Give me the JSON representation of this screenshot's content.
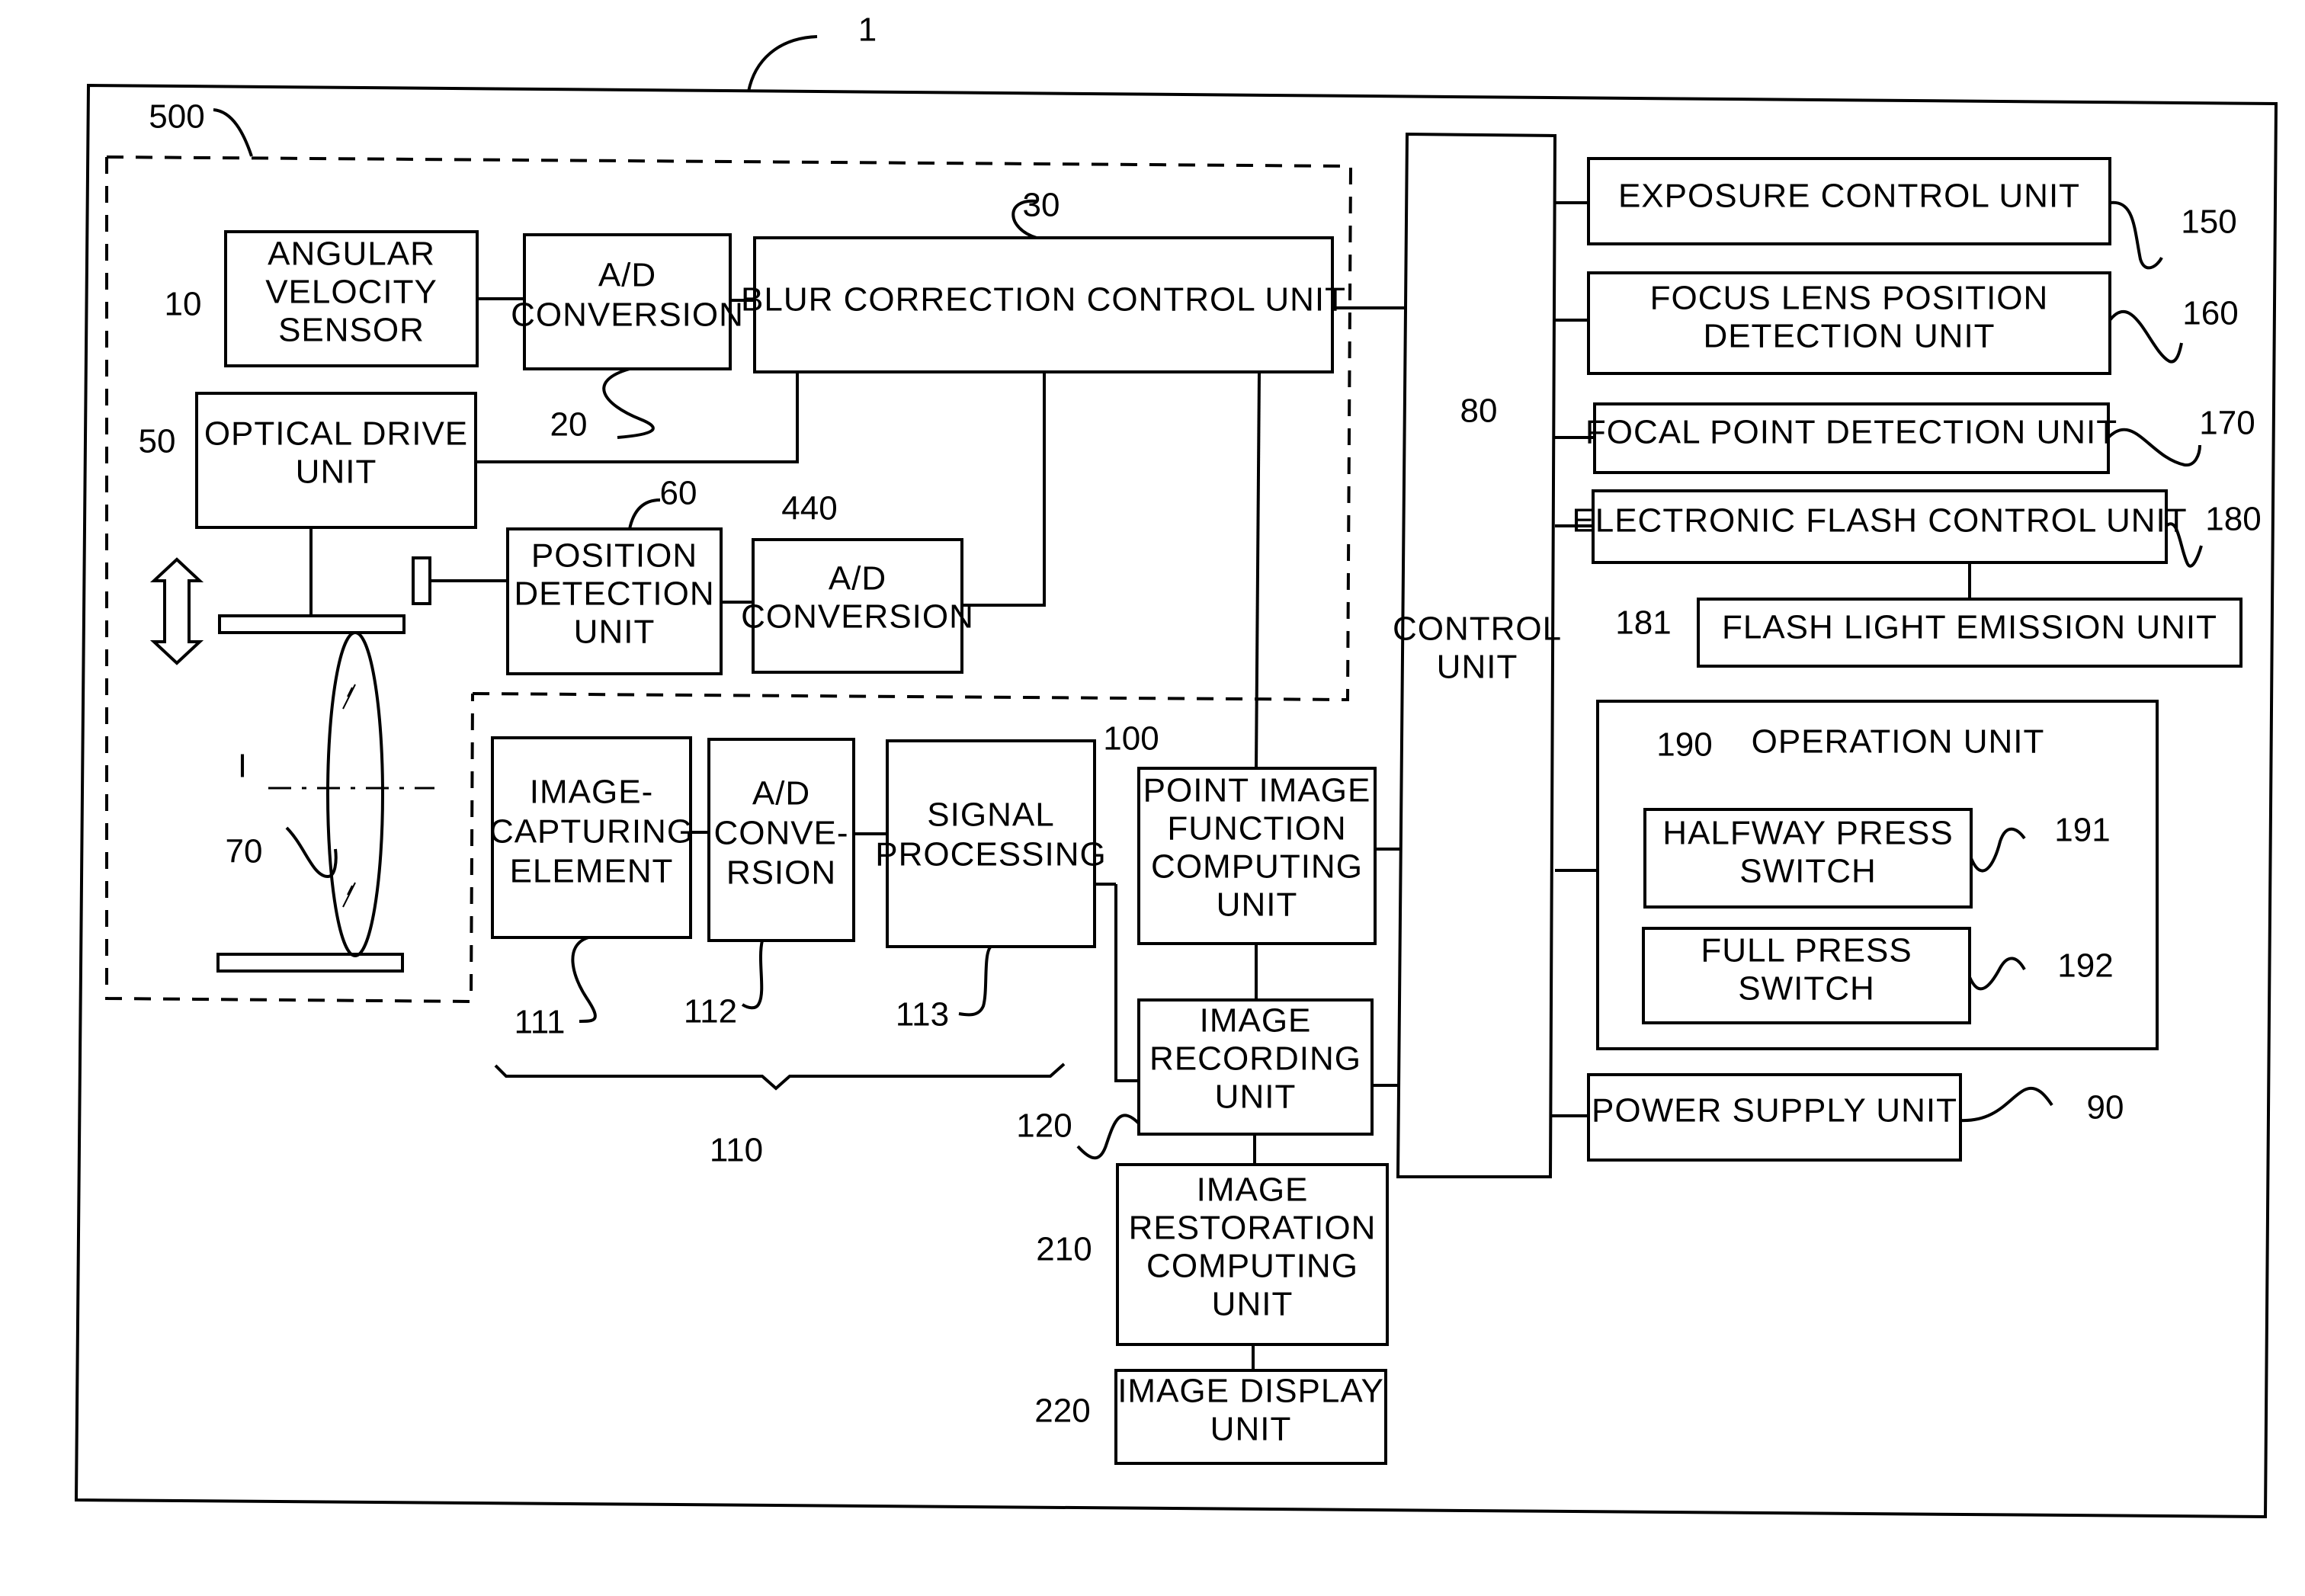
{
  "figure": {
    "ref": "1",
    "subsystem_ref": "500",
    "optical_axis_label": "I"
  },
  "blocks": {
    "angular_velocity_sensor": {
      "ref": "10",
      "lines": [
        "ANGULAR",
        "VELOCITY",
        "SENSOR"
      ]
    },
    "ad_conversion_20": {
      "ref": "20",
      "lines": [
        "A/D",
        "CONVERSION"
      ]
    },
    "blur_correction_control_unit": {
      "ref": "30",
      "lines": [
        "BLUR CORRECTION CONTROL UNIT"
      ]
    },
    "optical_drive_unit": {
      "ref": "50",
      "lines": [
        "OPTICAL DRIVE",
        "UNIT"
      ]
    },
    "position_detection_unit": {
      "ref": "60",
      "lines": [
        "POSITION",
        "DETECTION",
        "UNIT"
      ]
    },
    "ad_conversion_440": {
      "ref": "440",
      "lines": [
        "A/D",
        "CONVERSION"
      ]
    },
    "lens": {
      "ref": "70"
    },
    "control_unit": {
      "ref": "80",
      "lines": [
        "CONTROL",
        "UNIT"
      ]
    },
    "image_capturing_element": {
      "ref": "111",
      "lines": [
        "IMAGE-",
        "CAPTURING",
        "ELEMENT"
      ]
    },
    "ad_conversion_112": {
      "ref": "112",
      "lines": [
        "A/D",
        "CONVE-",
        "RSION"
      ]
    },
    "signal_processing": {
      "ref": "113",
      "lines": [
        "SIGNAL",
        "PROCESSING"
      ]
    },
    "image_capturing_group": {
      "ref": "110"
    },
    "point_image_function_computing_unit": {
      "ref": "100",
      "lines": [
        "POINT IMAGE",
        "FUNCTION",
        "COMPUTING",
        "UNIT"
      ]
    },
    "image_recording_unit": {
      "ref": "120",
      "lines": [
        "IMAGE",
        "RECORDING",
        "UNIT"
      ]
    },
    "image_restoration_computing_unit": {
      "ref": "210",
      "lines": [
        "IMAGE",
        "RESTORATION",
        "COMPUTING",
        "UNIT"
      ]
    },
    "image_display_unit": {
      "ref": "220",
      "lines": [
        "IMAGE DISPLAY",
        "UNIT"
      ]
    },
    "exposure_control_unit": {
      "ref": "150",
      "lines": [
        "EXPOSURE CONTROL UNIT"
      ]
    },
    "focus_lens_position_detection_unit": {
      "ref": "160",
      "lines": [
        "FOCUS LENS POSITION",
        "DETECTION UNIT"
      ]
    },
    "focal_point_detection_unit": {
      "ref": "170",
      "lines": [
        "FOCAL POINT DETECTION UNIT"
      ]
    },
    "electronic_flash_control_unit": {
      "ref": "180",
      "lines": [
        "ELECTRONIC FLASH CONTROL UNIT"
      ]
    },
    "flash_light_emission_unit": {
      "ref": "181",
      "lines": [
        "FLASH LIGHT EMISSION UNIT"
      ]
    },
    "operation_unit": {
      "ref": "190",
      "lines": [
        "OPERATION UNIT"
      ]
    },
    "halfway_press_switch": {
      "ref": "191",
      "lines": [
        "HALFWAY PRESS",
        "SWITCH"
      ]
    },
    "full_press_switch": {
      "ref": "192",
      "lines": [
        "FULL PRESS",
        "SWITCH"
      ]
    },
    "power_supply_unit": {
      "ref": "90",
      "lines": [
        "POWER SUPPLY UNIT"
      ]
    }
  }
}
